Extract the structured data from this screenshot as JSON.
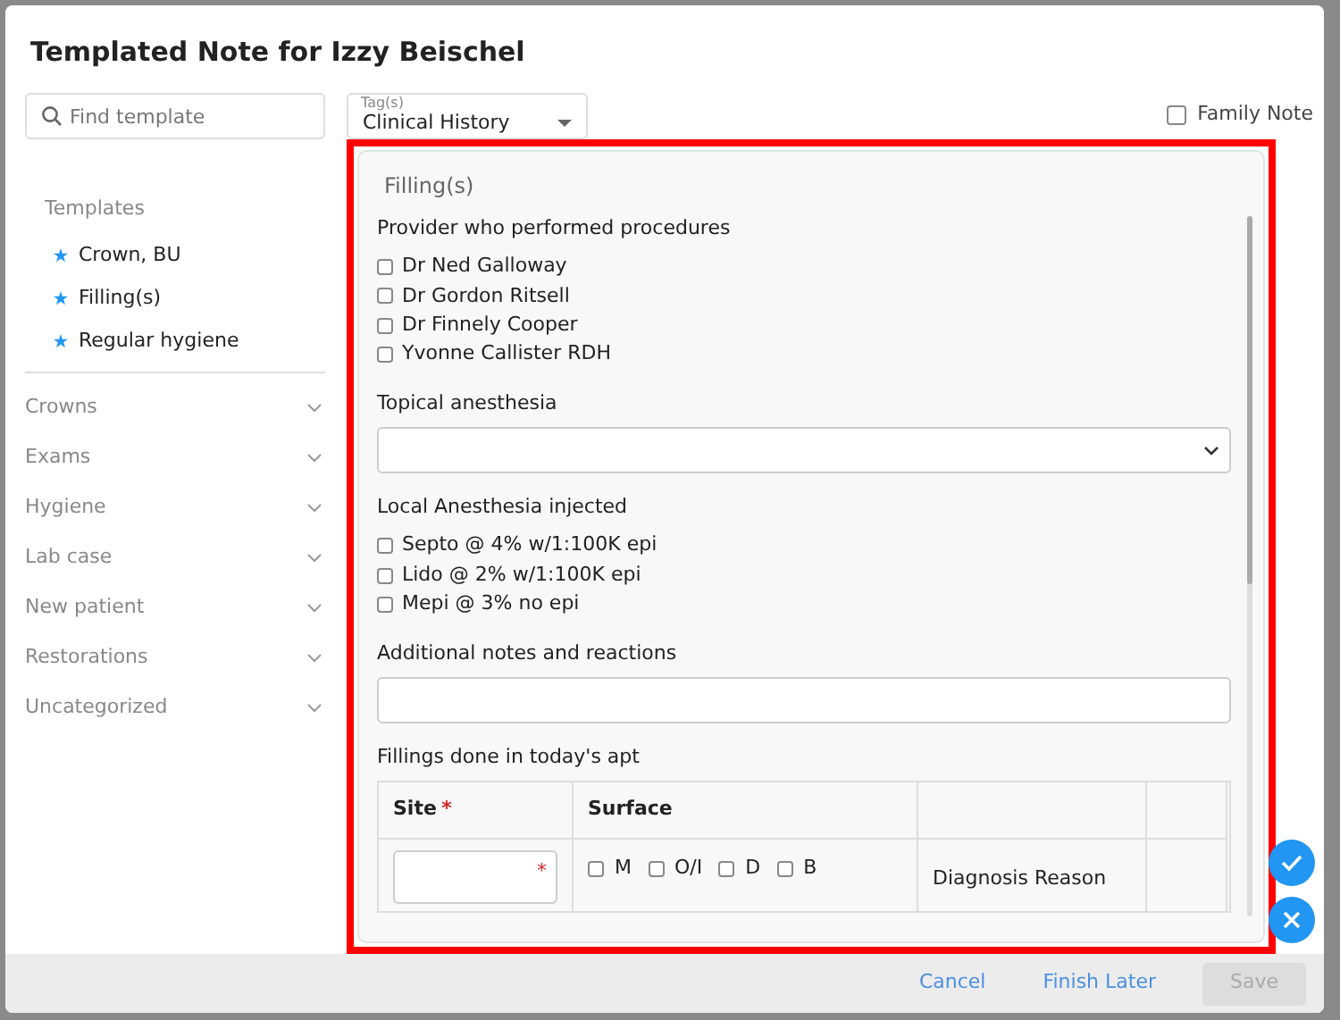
{
  "modal": {
    "title": "Templated Note for Izzy Beischel"
  },
  "search": {
    "placeholder": "Find template"
  },
  "tags": {
    "label": "Tag(s)",
    "value": "Clinical History"
  },
  "family_note": {
    "label": "Family Note",
    "checked": false
  },
  "templates": {
    "heading": "Templates",
    "items": [
      {
        "label": "Crown, BU"
      },
      {
        "label": "Filling(s)"
      },
      {
        "label": "Regular hygiene"
      }
    ]
  },
  "categories": [
    {
      "label": "Crowns",
      "expanded": false
    },
    {
      "label": "Exams",
      "expanded": false
    },
    {
      "label": "Hygiene",
      "expanded": false
    },
    {
      "label": "Lab case",
      "expanded": false
    },
    {
      "label": "New patient",
      "expanded": false
    },
    {
      "label": "Restorations",
      "expanded": false
    },
    {
      "label": "Uncategorized",
      "expanded": false
    }
  ],
  "form": {
    "title": "Filling(s)",
    "sections": [
      {
        "kind": "checkboxes",
        "label": "Provider who performed procedures",
        "options": [
          {
            "label": "Dr Ned Galloway",
            "checked": false
          },
          {
            "label": "Dr Gordon Ritsell",
            "checked": false
          },
          {
            "label": "Dr Finnely Cooper",
            "checked": false
          },
          {
            "label": "Yvonne Callister RDH",
            "checked": false
          }
        ]
      },
      {
        "kind": "select",
        "label": "Topical anesthesia"
      },
      {
        "kind": "checkboxes",
        "label": "Local Anesthesia injected",
        "options": [
          {
            "label": "Septo @ 4% w/1:100K epi",
            "checked": false
          },
          {
            "label": "Lido @ 2% w/1:100K epi",
            "checked": false
          },
          {
            "label": "Mepi @ 3% no epi",
            "checked": false
          }
        ]
      },
      {
        "kind": "text",
        "label": "Additional notes and reactions"
      },
      {
        "kind": "table",
        "label": "Fillings done in today's apt",
        "columns": [
          {
            "label": "Site",
            "marker": "*"
          },
          {
            "label": "Surface"
          }
        ],
        "row": {
          "site_marker": "*",
          "surfaces": [
            {
              "label": "M",
              "checked": false
            },
            {
              "label": "O/I",
              "checked": false
            },
            {
              "label": "D",
              "checked": false
            },
            {
              "label": "B",
              "checked": false
            }
          ],
          "column_3": "Diagnosis Reason"
        }
      }
    ]
  },
  "footer": [
    {
      "label": "Cancel",
      "kind": "link"
    },
    {
      "label": "Finish Later",
      "kind": "link"
    },
    {
      "label": "Save",
      "kind": "primary",
      "disabled": true
    }
  ]
}
